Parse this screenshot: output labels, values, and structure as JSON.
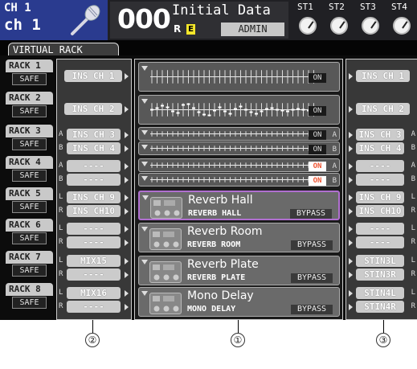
{
  "channel": {
    "line1": "CH 1",
    "line2": "ch 1",
    "icon": "microphone-icon"
  },
  "scene": {
    "number": "000",
    "title": "Initial Data",
    "r_indicator": "R",
    "e_indicator": "E",
    "user": "ADMIN"
  },
  "stereo_inputs": [
    "ST1",
    "ST2",
    "ST3",
    "ST4"
  ],
  "tab": {
    "label": "VIRTUAL RACK"
  },
  "racks": [
    {
      "label": "RACK 1",
      "safe": "SAFE"
    },
    {
      "label": "RACK 2",
      "safe": "SAFE"
    },
    {
      "label": "RACK 3",
      "safe": "SAFE"
    },
    {
      "label": "RACK 4",
      "safe": "SAFE"
    },
    {
      "label": "RACK 5",
      "safe": "SAFE"
    },
    {
      "label": "RACK 6",
      "safe": "SAFE"
    },
    {
      "label": "RACK 7",
      "safe": "SAFE"
    },
    {
      "label": "RACK 8",
      "safe": "SAFE"
    }
  ],
  "inputs": [
    {
      "rows": [
        {
          "side": "",
          "label": "INS CH 1"
        }
      ]
    },
    {
      "rows": [
        {
          "side": "",
          "label": "INS CH 2"
        }
      ]
    },
    {
      "rows": [
        {
          "side": "A",
          "label": "INS CH 3"
        },
        {
          "side": "B",
          "label": "INS CH 4"
        }
      ]
    },
    {
      "rows": [
        {
          "side": "A",
          "label": "----"
        },
        {
          "side": "B",
          "label": "----"
        }
      ]
    },
    {
      "rows": [
        {
          "side": "L",
          "label": "INS CH 9"
        },
        {
          "side": "R",
          "label": "INS CH10"
        }
      ]
    },
    {
      "rows": [
        {
          "side": "L",
          "label": "----"
        },
        {
          "side": "R",
          "label": "----"
        }
      ]
    },
    {
      "rows": [
        {
          "side": "L",
          "label": "MIX15"
        },
        {
          "side": "R",
          "label": "----"
        }
      ]
    },
    {
      "rows": [
        {
          "side": "L",
          "label": "MIX16"
        },
        {
          "side": "R",
          "label": "----"
        }
      ]
    }
  ],
  "outputs": [
    {
      "rows": [
        {
          "side": "",
          "label": "INS CH 1"
        }
      ]
    },
    {
      "rows": [
        {
          "side": "",
          "label": "INS CH 2"
        }
      ]
    },
    {
      "rows": [
        {
          "side": "A",
          "label": "INS CH 3"
        },
        {
          "side": "B",
          "label": "INS CH 4"
        }
      ]
    },
    {
      "rows": [
        {
          "side": "A",
          "label": "----"
        },
        {
          "side": "B",
          "label": "----"
        }
      ]
    },
    {
      "rows": [
        {
          "side": "L",
          "label": "INS CH 9"
        },
        {
          "side": "R",
          "label": "INS CH10"
        }
      ]
    },
    {
      "rows": [
        {
          "side": "L",
          "label": "----"
        },
        {
          "side": "R",
          "label": "----"
        }
      ]
    },
    {
      "rows": [
        {
          "side": "L",
          "label": "STIN3L"
        },
        {
          "side": "R",
          "label": "STIN3R"
        }
      ]
    },
    {
      "rows": [
        {
          "side": "L",
          "label": "STIN4L"
        },
        {
          "side": "R",
          "label": "STIN4R"
        }
      ]
    }
  ],
  "geq_racks": [
    {
      "on_label": "ON",
      "on_active": false,
      "side": ""
    },
    {
      "on_label": "ON",
      "on_active": false,
      "side": ""
    },
    {
      "on_label": "ON",
      "on_active": false,
      "side": "A"
    },
    {
      "on_label": "ON",
      "on_active": false,
      "side": "B"
    },
    {
      "on_label": "ON",
      "on_active": true,
      "side": "A"
    },
    {
      "on_label": "ON",
      "on_active": true,
      "side": "B"
    }
  ],
  "effects": [
    {
      "name": "Reverb Hall",
      "type": "REVERB HALL",
      "bypass": "BYPASS",
      "selected": true
    },
    {
      "name": "Reverb Room",
      "type": "REVERB ROOM",
      "bypass": "BYPASS",
      "selected": false
    },
    {
      "name": "Reverb Plate",
      "type": "REVERB PLATE",
      "bypass": "BYPASS",
      "selected": false
    },
    {
      "name": "Mono Delay",
      "type": "MONO DELAY",
      "bypass": "BYPASS",
      "selected": false
    }
  ],
  "callouts": [
    "②",
    "①",
    "③"
  ],
  "colors": {
    "ch_block": "#2a3b8f",
    "selected_border": "#b06fd0",
    "e_indicator": "#f4e62a",
    "on_active_text": "#e53"
  }
}
